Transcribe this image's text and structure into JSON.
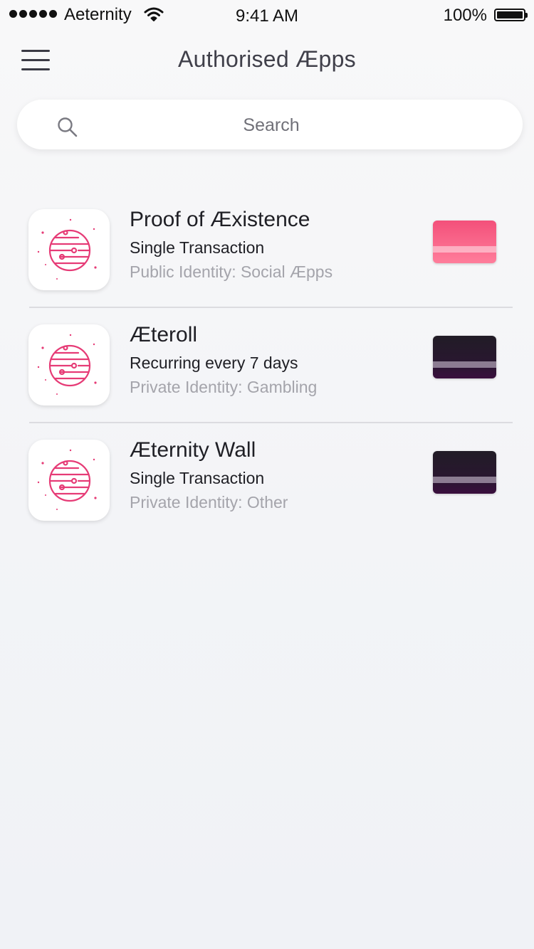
{
  "status_bar": {
    "carrier": "Aeternity",
    "time": "9:41 AM",
    "battery": "100%"
  },
  "header": {
    "title": "Authorised Æpps",
    "menu_icon": "hamburger-menu-icon"
  },
  "search": {
    "placeholder": "Search",
    "icon": "search-icon"
  },
  "apps": [
    {
      "name": "Proof of Æxistence",
      "type": "Single Transaction",
      "identity": "Public Identity: Social Æpps",
      "icon": "planet-icon",
      "card_color": "#f3507a"
    },
    {
      "name": "Æteroll",
      "type": "Recurring every 7 days",
      "identity": "Private Identity: Gambling",
      "icon": "planet-icon",
      "card_color": "#231c28"
    },
    {
      "name": "Æternity Wall",
      "type": "Single Transaction",
      "identity": "Private Identity: Other",
      "icon": "planet-icon",
      "card_color": "#231c28"
    }
  ],
  "colors": {
    "accent_pink": "#e8316a",
    "text_primary": "#1f1f25",
    "text_secondary": "#a4a4ab"
  }
}
